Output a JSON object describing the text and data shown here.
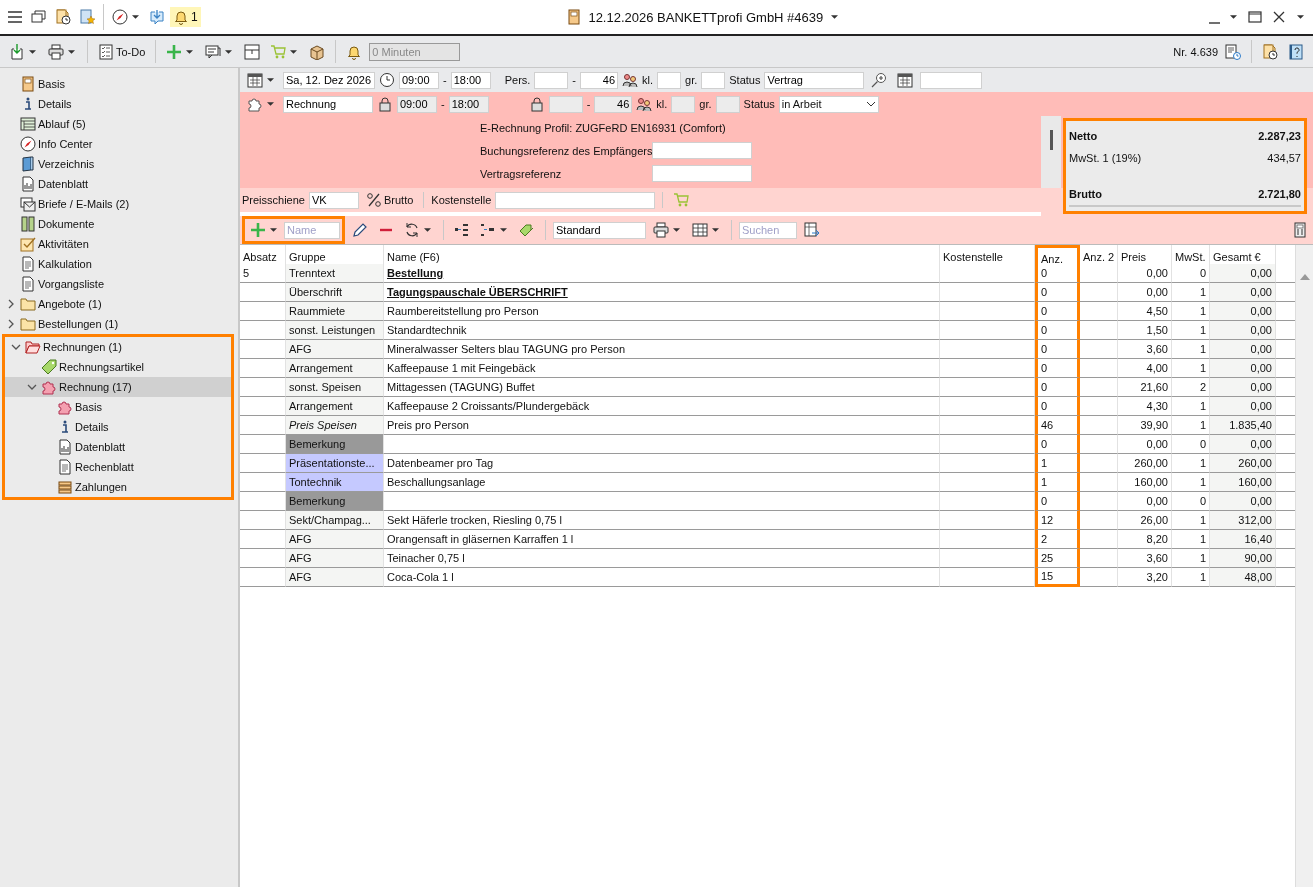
{
  "title_bar": {
    "notification_count": "1",
    "title": "12.12.2026 BANKETTprofi GmbH #4639"
  },
  "toolbar": {
    "todo_label": "To-Do",
    "minutes": "0 Minuten",
    "number": "Nr. 4.639"
  },
  "sidebar": {
    "items": [
      {
        "label": "Basis",
        "selected": false
      },
      {
        "label": "Details",
        "selected": false
      },
      {
        "label": "Ablauf (5)",
        "selected": false
      },
      {
        "label": "Info Center",
        "selected": false
      },
      {
        "label": "Verzeichnis",
        "selected": false
      },
      {
        "label": "Datenblatt",
        "selected": false
      },
      {
        "label": "Briefe / E-Mails (2)",
        "selected": false
      },
      {
        "label": "Dokumente",
        "selected": false
      },
      {
        "label": "Aktivitäten",
        "selected": false
      },
      {
        "label": "Kalkulation",
        "selected": false
      },
      {
        "label": "Vorgangsliste",
        "selected": false
      },
      {
        "label": "Angebote (1)",
        "selected": false,
        "expanded": false
      },
      {
        "label": "Bestellungen (1)",
        "selected": false,
        "expanded": false
      },
      {
        "label": "Rechnungen (1)",
        "selected": false,
        "expanded": true,
        "highlighted": true,
        "children": [
          {
            "label": "Rechnungsartikel",
            "selected": false
          },
          {
            "label": "Rechnung (17)",
            "selected": true,
            "expanded": true,
            "children": [
              {
                "label": "Basis",
                "selected": false
              },
              {
                "label": "Details",
                "selected": false
              },
              {
                "label": "Datenblatt",
                "selected": false
              },
              {
                "label": "Rechenblatt",
                "selected": false
              },
              {
                "label": "Zahlungen",
                "selected": false
              }
            ]
          }
        ]
      }
    ]
  },
  "event_row": {
    "date": "Sa, 12. Dez 2026",
    "start": "09:00",
    "time_separator": "-",
    "end": "18:00",
    "pers_separator": "-",
    "pers_label": "Pers.",
    "pers_to": "46",
    "kl_label": "kl.",
    "gr_label": "gr.",
    "status_label": "Status",
    "status": "Vertrag"
  },
  "invoice_row": {
    "name": "Rechnung",
    "start": "09:00",
    "time_separator": "-",
    "end": "18:00",
    "pers_separator": "-",
    "pers_to": "46",
    "kl_label": "kl.",
    "gr_label": "gr.",
    "status_label": "Status",
    "status": "in Arbeit"
  },
  "e_invoice": {
    "profile": "E-Rechnung Profil: ZUGFeRD EN16931 (Comfort)",
    "fields": [
      {
        "label": "Buchungsreferenz des Empfängers"
      },
      {
        "label": "Vertragsreferenz"
      }
    ]
  },
  "price_row": {
    "price_label": "Preisschiene",
    "price_list": "VK",
    "gross_label": "Brutto",
    "cost_center_label": "Kostenstelle"
  },
  "totals": {
    "highlighted": true,
    "rows": [
      {
        "label": "Netto",
        "value": "2.287,23",
        "kind": "bold"
      },
      {
        "label": "MwSt. 1 (19%)",
        "value": "434,57",
        "kind": "normal"
      },
      {
        "label": "Brutto",
        "value": "2.721,80",
        "kind": "total"
      }
    ]
  },
  "list_toolbar": {
    "highlighted": true,
    "name_placeholder": "Name",
    "layout": "Standard",
    "search_placeholder": "Suchen"
  },
  "table": {
    "columns": [
      {
        "label": "Absatz",
        "highlighted": false
      },
      {
        "label": "Gruppe",
        "highlighted": false
      },
      {
        "label": "Name (F6)",
        "highlighted": false
      },
      {
        "label": "Kostenstelle",
        "highlighted": false
      },
      {
        "label": "Anz.",
        "highlighted": true
      },
      {
        "label": "Anz. 2",
        "highlighted": false
      },
      {
        "label": "Preis",
        "highlighted": false
      },
      {
        "label": "MwSt.",
        "highlighted": false
      },
      {
        "label": "Gesamt €",
        "highlighted": false
      }
    ],
    "rows": [
      {
        "kind": "heading",
        "absatz": "5",
        "group": "Trenntext",
        "name": "Bestellung",
        "anz": "0",
        "preis": "0,00",
        "mwst": "0",
        "gesamt": "0,00"
      },
      {
        "kind": "heading",
        "group": "Überschrift",
        "name": "Tagungspauschale ÜBERSCHRIFT",
        "anz": "0",
        "preis": "0,00",
        "mwst": "1",
        "gesamt": "0,00"
      },
      {
        "kind": "item",
        "group": "Raummiete",
        "name": "Raumbereitstellung pro Person",
        "anz": "0",
        "preis": "4,50",
        "mwst": "1",
        "gesamt": "0,00"
      },
      {
        "kind": "item",
        "group": "sonst. Leistungen",
        "name": "Standardtechnik",
        "anz": "0",
        "preis": "1,50",
        "mwst": "1",
        "gesamt": "0,00"
      },
      {
        "kind": "item",
        "group": "AFG",
        "name": "Mineralwasser Selters blau TAGUNG pro Person",
        "anz": "0",
        "preis": "3,60",
        "mwst": "1",
        "gesamt": "0,00"
      },
      {
        "kind": "item",
        "group": "Arrangement",
        "name": "Kaffeepause 1 mit Feingebäck",
        "anz": "0",
        "preis": "4,00",
        "mwst": "1",
        "gesamt": "0,00"
      },
      {
        "kind": "item",
        "group": "sonst. Speisen",
        "name": "Mittagessen (TAGUNG) Buffet",
        "anz": "0",
        "preis": "21,60",
        "mwst": "2",
        "gesamt": "0,00"
      },
      {
        "kind": "item",
        "group": "Arrangement",
        "name": "Kaffeepause 2 Croissants/Plundergebäck",
        "anz": "0",
        "preis": "4,30",
        "mwst": "1",
        "gesamt": "0,00"
      },
      {
        "kind": "summary",
        "group": "Preis Speisen",
        "name": "Preis pro Person",
        "anz": "46",
        "preis": "39,90",
        "mwst": "1",
        "gesamt": "1.835,40"
      },
      {
        "kind": "comment",
        "group": "Bemerkung",
        "color": "#999999",
        "anz": "0",
        "preis": "0,00",
        "mwst": "0",
        "gesamt": "0,00"
      },
      {
        "kind": "item",
        "group": "Präsentationste...",
        "color": "#c5c9ff",
        "name": "Datenbeamer pro Tag",
        "anz": "1",
        "preis": "260,00",
        "mwst": "1",
        "gesamt": "260,00"
      },
      {
        "kind": "item",
        "group": "Tontechnik",
        "color": "#c5c9ff",
        "name": "Beschallungsanlage",
        "anz": "1",
        "preis": "160,00",
        "mwst": "1",
        "gesamt": "160,00"
      },
      {
        "kind": "comment",
        "group": "Bemerkung",
        "color": "#999999",
        "anz": "0",
        "preis": "0,00",
        "mwst": "0",
        "gesamt": "0,00"
      },
      {
        "kind": "item",
        "group": "Sekt/Champag...",
        "name": "Sekt Häferle trocken, Riesling 0,75 l",
        "anz": "12",
        "preis": "26,00",
        "mwst": "1",
        "gesamt": "312,00"
      },
      {
        "kind": "item",
        "group": "AFG",
        "name": "Orangensaft in gläsernen Karraffen 1 l",
        "anz": "2",
        "preis": "8,20",
        "mwst": "1",
        "gesamt": "16,40"
      },
      {
        "kind": "item",
        "group": "AFG",
        "name": "Teinacher 0,75 l",
        "anz": "25",
        "preis": "3,60",
        "mwst": "1",
        "gesamt": "90,00"
      },
      {
        "kind": "item",
        "group": "AFG",
        "name": "Coca-Cola 1 l",
        "anz": "15",
        "preis": "3,20",
        "mwst": "1",
        "gesamt": "48,00"
      }
    ]
  }
}
